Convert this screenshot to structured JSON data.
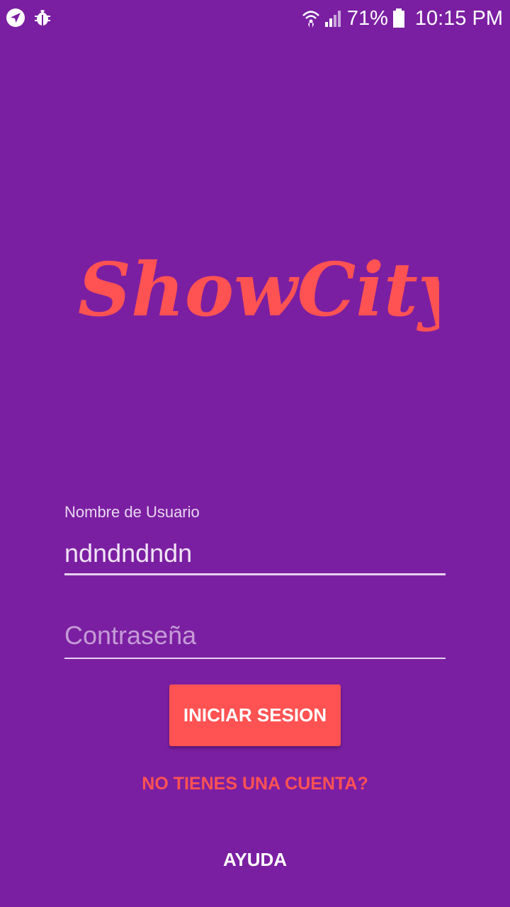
{
  "status_bar": {
    "battery_percent": "71%",
    "time": "10:15 PM",
    "icons": [
      "navigation-icon",
      "bug-icon",
      "wifi-icon",
      "signal-icon",
      "battery-icon"
    ]
  },
  "brand": {
    "logo_text": "ShowCity",
    "accent_color": "#ff5252",
    "background_color": "#7b1fa2"
  },
  "login_form": {
    "username": {
      "label": "Nombre de Usuario",
      "value": "ndndndndn"
    },
    "password": {
      "placeholder": "Contraseña",
      "value": ""
    },
    "submit_label": "INICIAR SESION",
    "signup_link": "NO TIENES UNA CUENTA?",
    "help_link": "AYUDA"
  }
}
